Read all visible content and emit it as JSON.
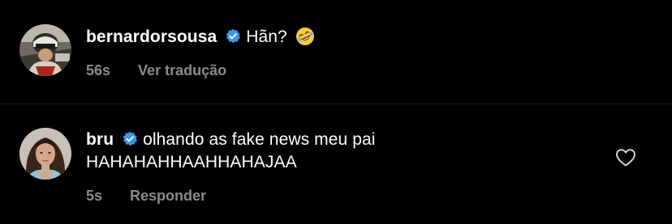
{
  "comments": [
    {
      "username": "bernardorsousa",
      "verified_icon": "verified-badge-icon",
      "text": "Hãn?",
      "emoji": "rolling-on-the-floor-laughing-emoji",
      "time": "56s",
      "action": "Ver tradução"
    },
    {
      "username": "bru",
      "verified_icon": "verified-badge-icon",
      "text_line1": "olhando as fake news meu pai",
      "text_line2": "HAHAHAHHAAHHAHAJAA",
      "time": "5s",
      "action": "Responder",
      "like_icon": "heart-outline-icon"
    }
  ],
  "colors": {
    "background": "#000000",
    "text": "#ffffff",
    "meta_text": "#8a8a8a",
    "verified_blue": "#3897f0"
  }
}
